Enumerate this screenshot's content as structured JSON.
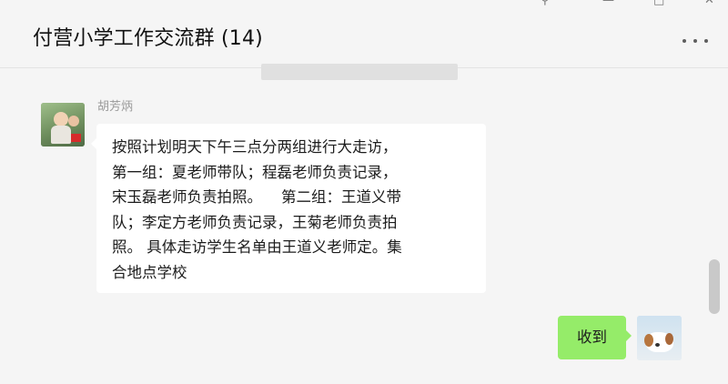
{
  "window": {
    "title": "付营小学工作交流群 (14)",
    "controls": [
      "pin-icon",
      "minimize-icon",
      "maximize-icon",
      "close-icon"
    ]
  },
  "header": {
    "more_icon": "ellipsis-icon"
  },
  "messages": [
    {
      "sender": "胡芳炳",
      "side": "left",
      "text": "按照计划明天下午三点分两组进行大走访，\n第一组：夏老师带队；程磊老师负责记录，\n宋玉磊老师负责拍照。    第二组：王道义带\n队；李定方老师负责记录，王菊老师负责拍\n照。 具体走访学生名单由王道义老师定。集\n合地点学校"
    },
    {
      "sender": "",
      "side": "right",
      "text": "收到"
    }
  ],
  "colors": {
    "sent_bubble": "#95ec69",
    "received_bubble": "#ffffff",
    "background": "#f5f5f5"
  }
}
